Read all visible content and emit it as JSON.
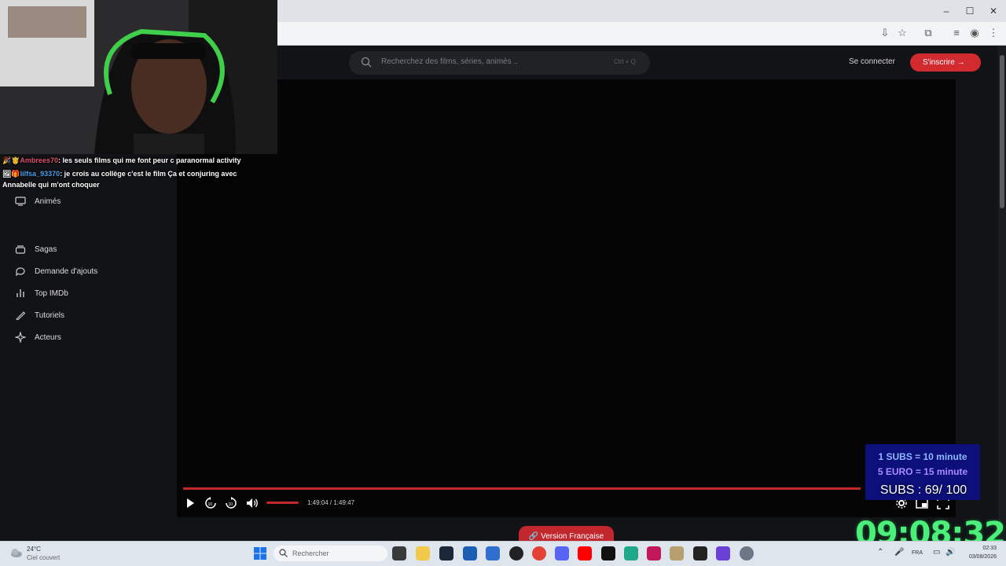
{
  "browser": {
    "window_controls": [
      "–",
      "☐",
      "✕"
    ],
    "toolbar_icons": [
      "install-icon",
      "star-icon",
      "extensions-icon",
      "tab-search-icon",
      "profile-icon",
      "menu-icon"
    ]
  },
  "site": {
    "search": {
      "placeholder": "Recherchez des films, séries, animés ..",
      "shortcut": "Ctrl + Q"
    },
    "login_label": "Se connecter",
    "signup_label": "S'inscrire",
    "sidebar": {
      "items": [
        {
          "label": "Animés",
          "icon": "tv-icon"
        },
        {
          "label": "Sagas",
          "icon": "stack-icon"
        },
        {
          "label": "Demande d'ajouts",
          "icon": "refresh-chat-icon"
        },
        {
          "label": "Top IMDb",
          "icon": "bar-chart-icon"
        },
        {
          "label": "Tutoriels",
          "icon": "pen-icon"
        },
        {
          "label": "Acteurs",
          "icon": "sparkle-icon"
        }
      ]
    },
    "player": {
      "time": "1:49:04 / 1:49:47",
      "progress_fraction": 0.9935,
      "volume_fraction": 1.0,
      "colors": {
        "accent": "#c1272d"
      }
    },
    "version_label": "Version Française"
  },
  "stream_overlay": {
    "chat": [
      {
        "badges": "🎉🤴",
        "user": "Ambrees70",
        "message": ": les seuls films qui me font peur c paranormal activity"
      },
      {
        "badges": "🖼🎁",
        "user": "lilfsa_93370",
        "message": ": je crois au collège c'est le film Ça et conjuring avec Annabelle qui m'ont choquer"
      }
    ],
    "subs_line1": "1 SUBS = 10 minute",
    "subs_line2": "5 EURO = 15 minute",
    "subs_count": "SUBS : 69/ 100",
    "timer": "09:08:32"
  },
  "taskbar": {
    "weather_temp": "24°C",
    "weather_desc": "Ciel couvert",
    "search_label": "Rechercher",
    "language": "FRA",
    "time": "02:33",
    "date": "03/08/2026"
  }
}
